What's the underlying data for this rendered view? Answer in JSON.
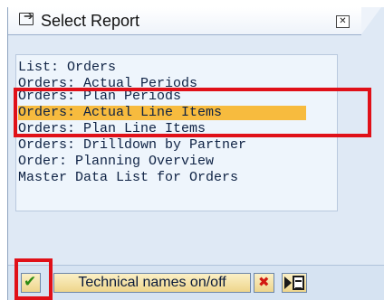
{
  "dialog": {
    "title": "Select Report",
    "close_glyph": "✕"
  },
  "report_list": {
    "items": [
      {
        "label": "List: Orders",
        "selected": false
      },
      {
        "label": "Orders: Actual Periods",
        "selected": false
      },
      {
        "label": "Orders: Plan Periods",
        "selected": false
      },
      {
        "label": "Orders: Actual Line Items",
        "selected": true
      },
      {
        "label": "Orders: Plan Line Items",
        "selected": false
      },
      {
        "label": "Orders: Drilldown by Partner",
        "selected": false
      },
      {
        "label": "Order: Planning Overview",
        "selected": false
      },
      {
        "label": "Master Data List for Orders",
        "selected": false
      }
    ]
  },
  "footer": {
    "technical_names_label": "Technical names on/off"
  },
  "icons": {
    "title": "report-select-icon",
    "confirm": "green-check-icon",
    "cancel": "red-x-icon",
    "doc": "document-arrow-icon"
  },
  "colors": {
    "selection": "#f7bb3e",
    "annotation_red": "#e01018",
    "footer_bg": "#d6e3f2"
  }
}
